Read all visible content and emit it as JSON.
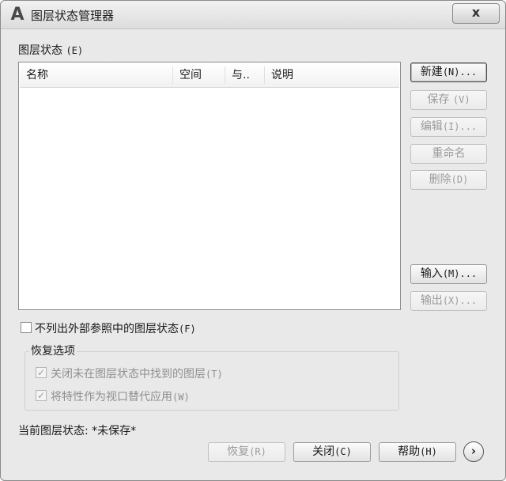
{
  "window": {
    "title": "图层状态管理器",
    "close_label": "x"
  },
  "layer_states": {
    "label": "图层状态",
    "shortcut": "(E)",
    "columns": [
      "名称",
      "空间",
      "与..",
      "说明"
    ],
    "rows": []
  },
  "side_buttons": {
    "new": {
      "label": "新建",
      "shortcut": "(N)..."
    },
    "save": {
      "label": "保存",
      "shortcut": "(V)"
    },
    "edit": {
      "label": "编辑",
      "shortcut": "(I)..."
    },
    "rename": {
      "label": "重命名"
    },
    "delete": {
      "label": "删除",
      "shortcut": "(D)"
    },
    "import": {
      "label": "输入",
      "shortcut": "(M)..."
    },
    "export": {
      "label": "输出",
      "shortcut": "(X)..."
    }
  },
  "exclude_xref": {
    "label": "不列出外部参照中的图层状态",
    "shortcut": "(F)",
    "checked": false
  },
  "restore_options": {
    "title": "恢复选项",
    "turn_off": {
      "label": "关闭未在图层状态中找到的图层",
      "shortcut": "(T)",
      "checked": true,
      "enabled": false
    },
    "apply_override": {
      "label": "将特性作为视口替代应用",
      "shortcut": "(W)",
      "checked": true,
      "enabled": false
    }
  },
  "current_state": {
    "label": "当前图层状态:",
    "value": "*未保存*"
  },
  "footer_buttons": {
    "restore": {
      "label": "恢复",
      "shortcut": "(R)"
    },
    "close": {
      "label": "关闭",
      "shortcut": "(C)"
    },
    "help": {
      "label": "帮助",
      "shortcut": "(H)"
    }
  },
  "icons": {
    "app": "autocad-icon",
    "more": "expand-arrow-icon"
  }
}
